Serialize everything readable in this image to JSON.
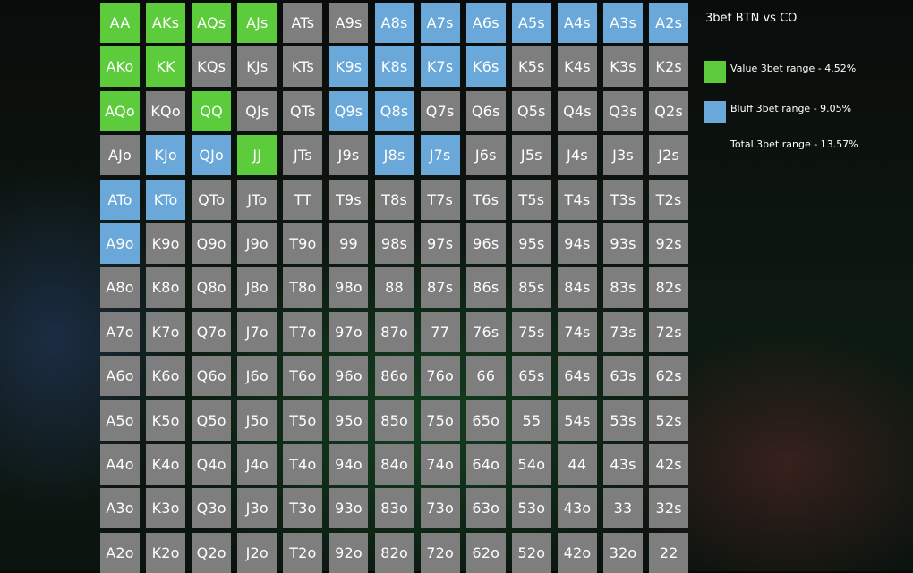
{
  "legend": {
    "title": "3bet BTN vs CO",
    "value_label": "Value 3bet range - 4.52%",
    "bluff_label": "Bluff 3bet range - 9.05%",
    "total_label": "Total 3bet range - 13.57%",
    "value_color": "#5ccb3c",
    "bluff_color": "#6aa8da",
    "fold_color": "#7e7e7e"
  },
  "grid": {
    "rows": [
      [
        {
          "hand": "AA",
          "cat": "value"
        },
        {
          "hand": "AKs",
          "cat": "value"
        },
        {
          "hand": "AQs",
          "cat": "value"
        },
        {
          "hand": "AJs",
          "cat": "value"
        },
        {
          "hand": "ATs",
          "cat": "fold"
        },
        {
          "hand": "A9s",
          "cat": "fold"
        },
        {
          "hand": "A8s",
          "cat": "bluff"
        },
        {
          "hand": "A7s",
          "cat": "bluff"
        },
        {
          "hand": "A6s",
          "cat": "bluff"
        },
        {
          "hand": "A5s",
          "cat": "bluff"
        },
        {
          "hand": "A4s",
          "cat": "bluff"
        },
        {
          "hand": "A3s",
          "cat": "bluff"
        },
        {
          "hand": "A2s",
          "cat": "bluff"
        }
      ],
      [
        {
          "hand": "AKo",
          "cat": "value"
        },
        {
          "hand": "KK",
          "cat": "value"
        },
        {
          "hand": "KQs",
          "cat": "fold"
        },
        {
          "hand": "KJs",
          "cat": "fold"
        },
        {
          "hand": "KTs",
          "cat": "fold"
        },
        {
          "hand": "K9s",
          "cat": "bluff"
        },
        {
          "hand": "K8s",
          "cat": "bluff"
        },
        {
          "hand": "K7s",
          "cat": "bluff"
        },
        {
          "hand": "K6s",
          "cat": "bluff"
        },
        {
          "hand": "K5s",
          "cat": "fold"
        },
        {
          "hand": "K4s",
          "cat": "fold"
        },
        {
          "hand": "K3s",
          "cat": "fold"
        },
        {
          "hand": "K2s",
          "cat": "fold"
        }
      ],
      [
        {
          "hand": "AQo",
          "cat": "value"
        },
        {
          "hand": "KQo",
          "cat": "fold"
        },
        {
          "hand": "QQ",
          "cat": "value"
        },
        {
          "hand": "QJs",
          "cat": "fold"
        },
        {
          "hand": "QTs",
          "cat": "fold"
        },
        {
          "hand": "Q9s",
          "cat": "bluff"
        },
        {
          "hand": "Q8s",
          "cat": "bluff"
        },
        {
          "hand": "Q7s",
          "cat": "fold"
        },
        {
          "hand": "Q6s",
          "cat": "fold"
        },
        {
          "hand": "Q5s",
          "cat": "fold"
        },
        {
          "hand": "Q4s",
          "cat": "fold"
        },
        {
          "hand": "Q3s",
          "cat": "fold"
        },
        {
          "hand": "Q2s",
          "cat": "fold"
        }
      ],
      [
        {
          "hand": "AJo",
          "cat": "fold"
        },
        {
          "hand": "KJo",
          "cat": "bluff"
        },
        {
          "hand": "QJo",
          "cat": "bluff"
        },
        {
          "hand": "JJ",
          "cat": "value"
        },
        {
          "hand": "JTs",
          "cat": "fold"
        },
        {
          "hand": "J9s",
          "cat": "fold"
        },
        {
          "hand": "J8s",
          "cat": "bluff"
        },
        {
          "hand": "J7s",
          "cat": "bluff"
        },
        {
          "hand": "J6s",
          "cat": "fold"
        },
        {
          "hand": "J5s",
          "cat": "fold"
        },
        {
          "hand": "J4s",
          "cat": "fold"
        },
        {
          "hand": "J3s",
          "cat": "fold"
        },
        {
          "hand": "J2s",
          "cat": "fold"
        }
      ],
      [
        {
          "hand": "ATo",
          "cat": "bluff"
        },
        {
          "hand": "KTo",
          "cat": "bluff"
        },
        {
          "hand": "QTo",
          "cat": "fold"
        },
        {
          "hand": "JTo",
          "cat": "fold"
        },
        {
          "hand": "TT",
          "cat": "fold"
        },
        {
          "hand": "T9s",
          "cat": "fold"
        },
        {
          "hand": "T8s",
          "cat": "fold"
        },
        {
          "hand": "T7s",
          "cat": "fold"
        },
        {
          "hand": "T6s",
          "cat": "fold"
        },
        {
          "hand": "T5s",
          "cat": "fold"
        },
        {
          "hand": "T4s",
          "cat": "fold"
        },
        {
          "hand": "T3s",
          "cat": "fold"
        },
        {
          "hand": "T2s",
          "cat": "fold"
        }
      ],
      [
        {
          "hand": "A9o",
          "cat": "bluff"
        },
        {
          "hand": "K9o",
          "cat": "fold"
        },
        {
          "hand": "Q9o",
          "cat": "fold"
        },
        {
          "hand": "J9o",
          "cat": "fold"
        },
        {
          "hand": "T9o",
          "cat": "fold"
        },
        {
          "hand": "99",
          "cat": "fold"
        },
        {
          "hand": "98s",
          "cat": "fold"
        },
        {
          "hand": "97s",
          "cat": "fold"
        },
        {
          "hand": "96s",
          "cat": "fold"
        },
        {
          "hand": "95s",
          "cat": "fold"
        },
        {
          "hand": "94s",
          "cat": "fold"
        },
        {
          "hand": "93s",
          "cat": "fold"
        },
        {
          "hand": "92s",
          "cat": "fold"
        }
      ],
      [
        {
          "hand": "A8o",
          "cat": "fold"
        },
        {
          "hand": "K8o",
          "cat": "fold"
        },
        {
          "hand": "Q8o",
          "cat": "fold"
        },
        {
          "hand": "J8o",
          "cat": "fold"
        },
        {
          "hand": "T8o",
          "cat": "fold"
        },
        {
          "hand": "98o",
          "cat": "fold"
        },
        {
          "hand": "88",
          "cat": "fold"
        },
        {
          "hand": "87s",
          "cat": "fold"
        },
        {
          "hand": "86s",
          "cat": "fold"
        },
        {
          "hand": "85s",
          "cat": "fold"
        },
        {
          "hand": "84s",
          "cat": "fold"
        },
        {
          "hand": "83s",
          "cat": "fold"
        },
        {
          "hand": "82s",
          "cat": "fold"
        }
      ],
      [
        {
          "hand": "A7o",
          "cat": "fold"
        },
        {
          "hand": "K7o",
          "cat": "fold"
        },
        {
          "hand": "Q7o",
          "cat": "fold"
        },
        {
          "hand": "J7o",
          "cat": "fold"
        },
        {
          "hand": "T7o",
          "cat": "fold"
        },
        {
          "hand": "97o",
          "cat": "fold"
        },
        {
          "hand": "87o",
          "cat": "fold"
        },
        {
          "hand": "77",
          "cat": "fold"
        },
        {
          "hand": "76s",
          "cat": "fold"
        },
        {
          "hand": "75s",
          "cat": "fold"
        },
        {
          "hand": "74s",
          "cat": "fold"
        },
        {
          "hand": "73s",
          "cat": "fold"
        },
        {
          "hand": "72s",
          "cat": "fold"
        }
      ],
      [
        {
          "hand": "A6o",
          "cat": "fold"
        },
        {
          "hand": "K6o",
          "cat": "fold"
        },
        {
          "hand": "Q6o",
          "cat": "fold"
        },
        {
          "hand": "J6o",
          "cat": "fold"
        },
        {
          "hand": "T6o",
          "cat": "fold"
        },
        {
          "hand": "96o",
          "cat": "fold"
        },
        {
          "hand": "86o",
          "cat": "fold"
        },
        {
          "hand": "76o",
          "cat": "fold"
        },
        {
          "hand": "66",
          "cat": "fold"
        },
        {
          "hand": "65s",
          "cat": "fold"
        },
        {
          "hand": "64s",
          "cat": "fold"
        },
        {
          "hand": "63s",
          "cat": "fold"
        },
        {
          "hand": "62s",
          "cat": "fold"
        }
      ],
      [
        {
          "hand": "A5o",
          "cat": "fold"
        },
        {
          "hand": "K5o",
          "cat": "fold"
        },
        {
          "hand": "Q5o",
          "cat": "fold"
        },
        {
          "hand": "J5o",
          "cat": "fold"
        },
        {
          "hand": "T5o",
          "cat": "fold"
        },
        {
          "hand": "95o",
          "cat": "fold"
        },
        {
          "hand": "85o",
          "cat": "fold"
        },
        {
          "hand": "75o",
          "cat": "fold"
        },
        {
          "hand": "65o",
          "cat": "fold"
        },
        {
          "hand": "55",
          "cat": "fold"
        },
        {
          "hand": "54s",
          "cat": "fold"
        },
        {
          "hand": "53s",
          "cat": "fold"
        },
        {
          "hand": "52s",
          "cat": "fold"
        }
      ],
      [
        {
          "hand": "A4o",
          "cat": "fold"
        },
        {
          "hand": "K4o",
          "cat": "fold"
        },
        {
          "hand": "Q4o",
          "cat": "fold"
        },
        {
          "hand": "J4o",
          "cat": "fold"
        },
        {
          "hand": "T4o",
          "cat": "fold"
        },
        {
          "hand": "94o",
          "cat": "fold"
        },
        {
          "hand": "84o",
          "cat": "fold"
        },
        {
          "hand": "74o",
          "cat": "fold"
        },
        {
          "hand": "64o",
          "cat": "fold"
        },
        {
          "hand": "54o",
          "cat": "fold"
        },
        {
          "hand": "44",
          "cat": "fold"
        },
        {
          "hand": "43s",
          "cat": "fold"
        },
        {
          "hand": "42s",
          "cat": "fold"
        }
      ],
      [
        {
          "hand": "A3o",
          "cat": "fold"
        },
        {
          "hand": "K3o",
          "cat": "fold"
        },
        {
          "hand": "Q3o",
          "cat": "fold"
        },
        {
          "hand": "J3o",
          "cat": "fold"
        },
        {
          "hand": "T3o",
          "cat": "fold"
        },
        {
          "hand": "93o",
          "cat": "fold"
        },
        {
          "hand": "83o",
          "cat": "fold"
        },
        {
          "hand": "73o",
          "cat": "fold"
        },
        {
          "hand": "63o",
          "cat": "fold"
        },
        {
          "hand": "53o",
          "cat": "fold"
        },
        {
          "hand": "43o",
          "cat": "fold"
        },
        {
          "hand": "33",
          "cat": "fold"
        },
        {
          "hand": "32s",
          "cat": "fold"
        }
      ],
      [
        {
          "hand": "A2o",
          "cat": "fold"
        },
        {
          "hand": "K2o",
          "cat": "fold"
        },
        {
          "hand": "Q2o",
          "cat": "fold"
        },
        {
          "hand": "J2o",
          "cat": "fold"
        },
        {
          "hand": "T2o",
          "cat": "fold"
        },
        {
          "hand": "92o",
          "cat": "fold"
        },
        {
          "hand": "82o",
          "cat": "fold"
        },
        {
          "hand": "72o",
          "cat": "fold"
        },
        {
          "hand": "62o",
          "cat": "fold"
        },
        {
          "hand": "52o",
          "cat": "fold"
        },
        {
          "hand": "42o",
          "cat": "fold"
        },
        {
          "hand": "32o",
          "cat": "fold"
        },
        {
          "hand": "22",
          "cat": "fold"
        }
      ]
    ]
  }
}
